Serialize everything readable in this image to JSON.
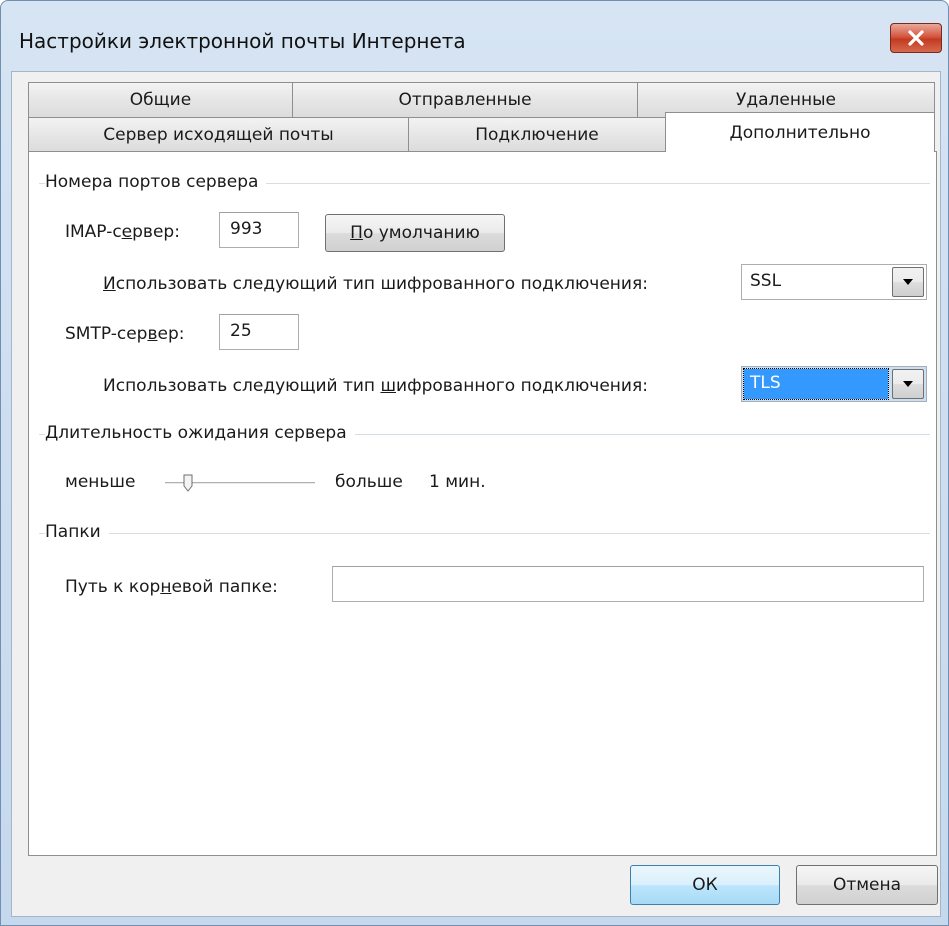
{
  "window": {
    "title": "Настройки электронной почты Интернета"
  },
  "tabs": {
    "row_back": [
      "Общие",
      "Отправленные",
      "Удаленные"
    ],
    "row_front": [
      "Сервер исходящей почты",
      "Подключение",
      "Дополнительно"
    ],
    "active": "Дополнительно"
  },
  "ports": {
    "group_label": "Номера портов сервера",
    "imap_label": "IMAP-сервер:",
    "imap_value": "993",
    "default_button": "По умолчанию",
    "imap_encryption_label": "Использовать следующий тип шифрованного подключения:",
    "imap_encryption_value": "SSL",
    "smtp_label": "SMTP-сервер:",
    "smtp_value": "25",
    "smtp_encryption_label": "Использовать следующий тип шифрованного подключения:",
    "smtp_encryption_value": "TLS"
  },
  "timeout": {
    "group_label": "Длительность ожидания сервера",
    "less_label": "меньше",
    "more_label": "больше",
    "value_label": "1 мин.",
    "slider_fraction": 0.0
  },
  "folders": {
    "group_label": "Папки",
    "root_path_label": "Путь к корневой папке:",
    "root_path_value": ""
  },
  "footer": {
    "ok_label": "ОК",
    "cancel_label": "Отмена"
  }
}
